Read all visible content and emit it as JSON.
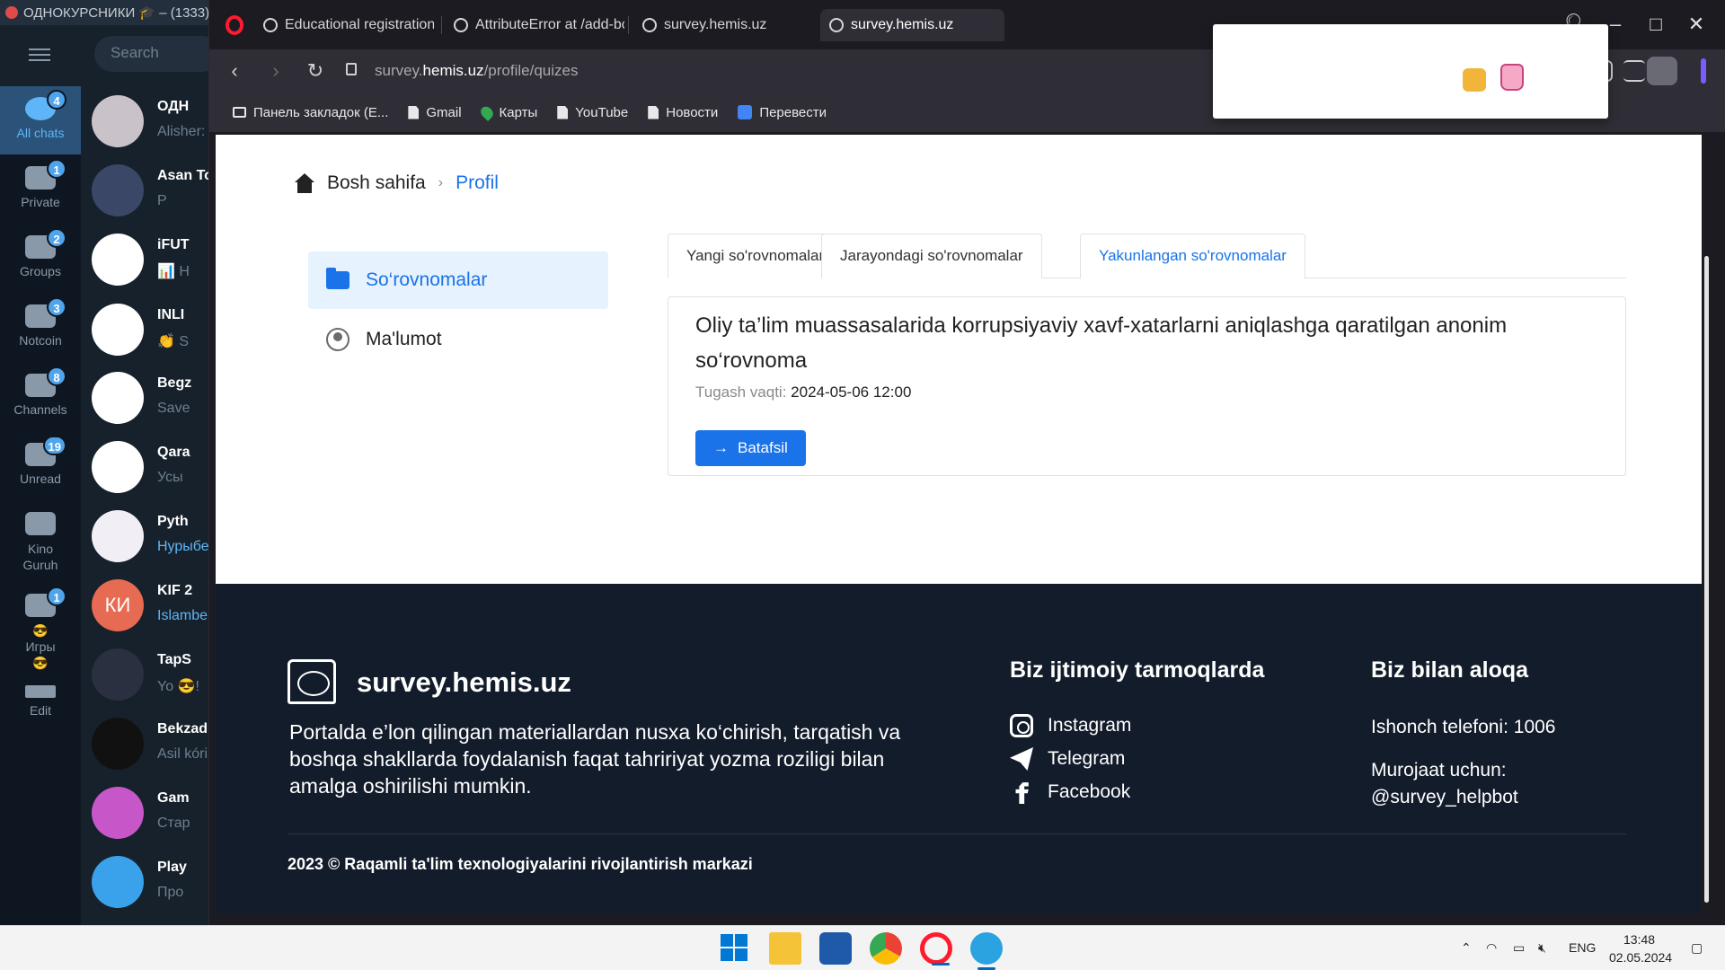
{
  "telegram": {
    "title": "ОДНОКУРСНИКИ 🎓 – (1333)",
    "search_placeholder": "Search",
    "folders": [
      {
        "label": "All chats",
        "badge": "4"
      },
      {
        "label": "Private",
        "badge": "1"
      },
      {
        "label": "Groups",
        "badge": "2"
      },
      {
        "label": "Notcoin",
        "badge": "3"
      },
      {
        "label": "Channels",
        "badge": "8"
      },
      {
        "label": "Unread",
        "badge": "19"
      },
      {
        "label": "Kino Guruh",
        "badge": ""
      },
      {
        "label": "😎Игры😎",
        "badge": "1"
      },
      {
        "label": "Edit",
        "badge": ""
      }
    ],
    "chats": [
      {
        "title": "ОДН",
        "preview": "Alisher:",
        "color": "#c9c2c8"
      },
      {
        "title": "Asan To",
        "preview": "P",
        "color": "#3b4766"
      },
      {
        "title": "iFUT",
        "preview": "📊 H",
        "color": "#ffffff"
      },
      {
        "title": "INLI",
        "preview": "👏 S",
        "color": "#ffffff"
      },
      {
        "title": "Begz",
        "preview": "Save",
        "color": "#ffffff"
      },
      {
        "title": "Qara",
        "preview": "Усы",
        "color": "#ffffff"
      },
      {
        "title": "Pyth",
        "preview": "Нурыбе",
        "color": "#f1eef5"
      },
      {
        "title": "KIF 2",
        "preview": "Islambe",
        "color": "#e76a52"
      },
      {
        "title": "TapS",
        "preview": "Yo 😎!",
        "color": "#2b3040"
      },
      {
        "title": "Bekzad",
        "preview": "Asil kóri",
        "color": "#111111"
      },
      {
        "title": "Gam",
        "preview": "Стар",
        "color": "#c757c9"
      },
      {
        "title": "Play",
        "preview": "Про",
        "color": "#3aa2ea"
      }
    ],
    "ki_initials": "КИ"
  },
  "browser": {
    "tabs": [
      {
        "label": "Educational registration fo"
      },
      {
        "label": "AttributeError at /add-boo"
      },
      {
        "label": "survey.hemis.uz"
      },
      {
        "label": "survey.hemis.uz"
      }
    ],
    "url_prefix": "survey.",
    "url_host": "hemis.uz",
    "url_path": "/profile/quizes",
    "bookmarks": [
      {
        "label": "Панель закладок (E...",
        "icon": "folder"
      },
      {
        "label": "Gmail",
        "icon": "page"
      },
      {
        "label": "Карты",
        "icon": "map-pin"
      },
      {
        "label": "YouTube",
        "icon": "page"
      },
      {
        "label": "Новости",
        "icon": "page"
      },
      {
        "label": "Перевести",
        "icon": "translate"
      }
    ]
  },
  "page": {
    "breadcrumb": {
      "home": "Bosh sahifa",
      "current": "Profil"
    },
    "menu": [
      {
        "label": "So‘rovnomalar"
      },
      {
        "label": "Ma'lumot"
      }
    ],
    "tabs": [
      {
        "label": "Yangi so'rovnomalar"
      },
      {
        "label": "Jarayondagi so'rovnomalar"
      },
      {
        "label": "Yakunlangan so'rovnomalar"
      }
    ],
    "card": {
      "title": "Oliy ta’lim muassasalarida korrupsiyaviy xavf-xatarlarni aniqlashga qaratilgan anonim so‘rovnoma",
      "deadline_label": "Tugash vaqti:",
      "deadline_value": "2024-05-06 12:00",
      "button_arrow": "→",
      "button_label": "Batafsil"
    },
    "footer": {
      "brand": "survey.hemis.uz",
      "description": "Portalda e’lon qilingan materiallardan nusxa ko‘chirish, tarqatish va boshqa shakllarda foydalanish faqat tahririyat yozma roziligi bilan amalga oshirilishi mumkin.",
      "social_title": "Biz ijtimoiy tarmoqlarda",
      "social": [
        "Instagram",
        "Telegram",
        "Facebook"
      ],
      "contact_title": "Biz bilan aloqa",
      "phone": "Ishonch telefoni: 1006",
      "murojaat": "Murojaat uchun: @survey_helpbot",
      "copyright": "2023 © Raqamli ta'lim texnologiyalarini rivojlantirish markazi"
    }
  },
  "taskbar": {
    "lang": "ENG",
    "time": "13:48",
    "date": "02.05.2024"
  },
  "colors": {
    "accent": "#1a73e8",
    "footer_bg": "#131c2b",
    "opera_red": "#ff1b2d"
  }
}
